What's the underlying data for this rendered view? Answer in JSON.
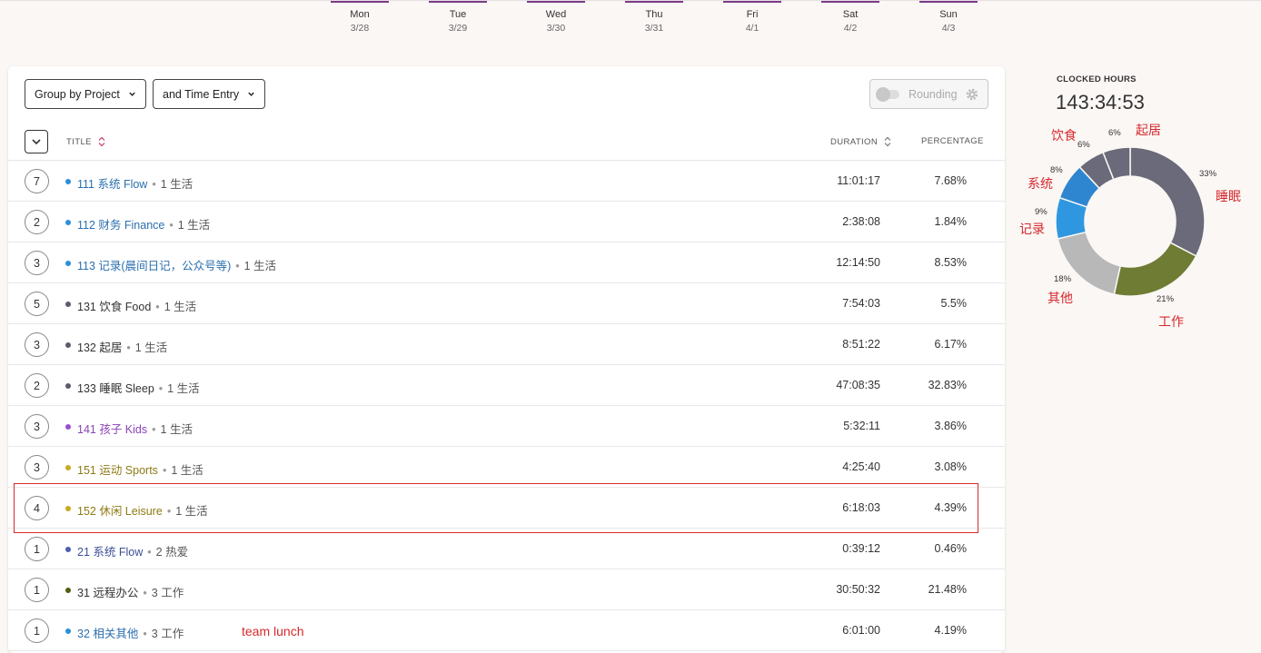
{
  "week": [
    {
      "day": "Mon",
      "date": "3/28"
    },
    {
      "day": "Tue",
      "date": "3/29"
    },
    {
      "day": "Wed",
      "date": "3/30"
    },
    {
      "day": "Thu",
      "date": "3/31"
    },
    {
      "day": "Fri",
      "date": "4/1"
    },
    {
      "day": "Sat",
      "date": "4/2"
    },
    {
      "day": "Sun",
      "date": "4/3"
    }
  ],
  "toolbar": {
    "group_by": "Group by Project",
    "then_by": "and Time Entry",
    "rounding": "Rounding"
  },
  "table": {
    "col_title": "TITLE",
    "col_duration": "DURATION",
    "col_percentage": "PERCENTAGE",
    "rows": [
      {
        "count": "7",
        "title": "111 系统 Flow",
        "client": "1 生活",
        "duration": "11:01:17",
        "percent": "7.68%",
        "color": "#2b8fd8",
        "title_color": "#2b6fae"
      },
      {
        "count": "2",
        "title": "112 财务 Finance",
        "client": "1 生活",
        "duration": "2:38:08",
        "percent": "1.84%",
        "color": "#2b8fd8",
        "title_color": "#2b6fae"
      },
      {
        "count": "3",
        "title": "113 记录(晨间日记，公众号等)",
        "client": "1 生活",
        "duration": "12:14:50",
        "percent": "8.53%",
        "color": "#2b8fd8",
        "title_color": "#2b6fae"
      },
      {
        "count": "5",
        "title": "131 饮食 Food",
        "client": "1 生活",
        "duration": "7:54:03",
        "percent": "5.5%",
        "color": "#5c5a6e",
        "title_color": "#333333"
      },
      {
        "count": "3",
        "title": "132  起居",
        "client": "1 生活",
        "duration": "8:51:22",
        "percent": "6.17%",
        "color": "#5c5a6e",
        "title_color": "#333333"
      },
      {
        "count": "2",
        "title": "133 睡眠 Sleep",
        "client": "1 生活",
        "duration": "47:08:35",
        "percent": "32.83%",
        "color": "#5c5a6e",
        "title_color": "#333333"
      },
      {
        "count": "3",
        "title": "141 孩子 Kids",
        "client": "1 生活",
        "duration": "5:32:11",
        "percent": "3.86%",
        "color": "#9b4fd0",
        "title_color": "#8a44b8"
      },
      {
        "count": "3",
        "title": "151 运动 Sports",
        "client": "1 生活",
        "duration": "4:25:40",
        "percent": "3.08%",
        "color": "#c8aa1e",
        "title_color": "#8c7a14"
      },
      {
        "count": "4",
        "title": "152 休闲 Leisure",
        "client": "1 生活",
        "duration": "6:18:03",
        "percent": "4.39%",
        "color": "#c8aa1e",
        "title_color": "#8c7a14"
      },
      {
        "count": "1",
        "title": "21 系统 Flow",
        "client": "2 热爱",
        "duration": "0:39:12",
        "percent": "0.46%",
        "color": "#4a5fb0",
        "title_color": "#3b4f96"
      },
      {
        "count": "1",
        "title": "31 远程办公",
        "client": "3 工作",
        "duration": "30:50:32",
        "percent": "21.48%",
        "color": "#4f5f12",
        "title_color": "#333333"
      },
      {
        "count": "1",
        "title": "32 相关其他",
        "client": "3 工作",
        "duration": "6:01:00",
        "percent": "4.19%",
        "color": "#2b8fd8",
        "title_color": "#2b6fae"
      }
    ]
  },
  "annotation_note": "team lunch",
  "summary": {
    "label": "CLOCKED HOURS",
    "total": "143:34:53"
  },
  "donut": {
    "slices": [
      {
        "pct": "33%",
        "value": 33,
        "color": "#6b6a7a",
        "label": "睡眠"
      },
      {
        "pct": "21%",
        "value": 21,
        "color": "#6e7c34",
        "label": "工作"
      },
      {
        "pct": "18%",
        "value": 18,
        "color": "#b8b8b8",
        "label": "其他"
      },
      {
        "pct": "9%",
        "value": 9,
        "color": "#2f97e0",
        "label": "记录"
      },
      {
        "pct": "8%",
        "value": 8,
        "color": "#2f86d0",
        "label": "系统"
      },
      {
        "pct": "6%",
        "value": 6,
        "color": "#6b6a7a",
        "label": "饮食"
      },
      {
        "pct": "6%",
        "value": 6,
        "color": "#6b6a7a",
        "label": "起居"
      }
    ]
  }
}
